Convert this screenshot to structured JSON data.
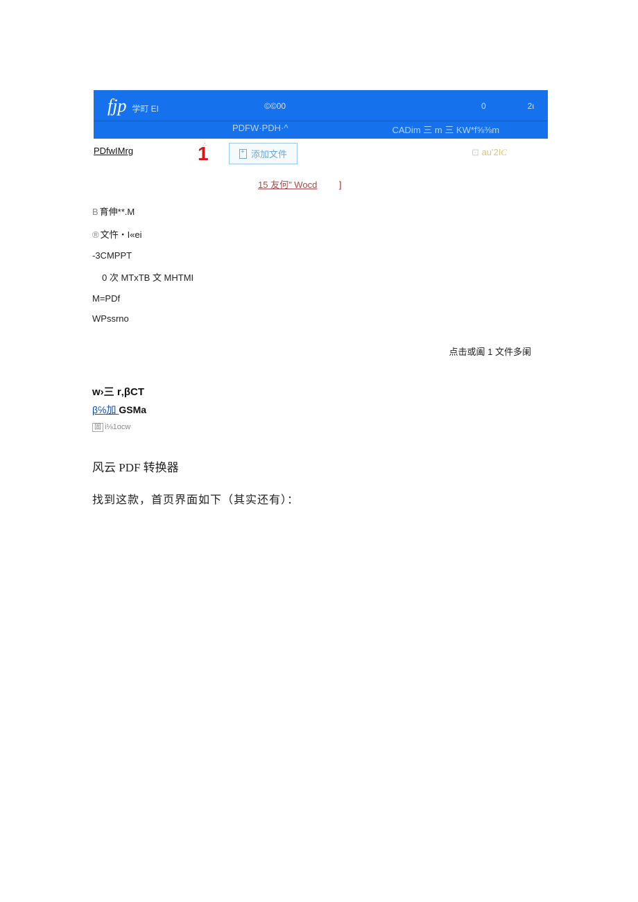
{
  "header": {
    "logo": "fjp",
    "logo_suffix": "学町 EI",
    "center": "©©00",
    "right1": "0",
    "right2": "2ι",
    "sub_left": "PDFW·PDH·^",
    "sub_right": "CADim 三 m 三 KW*f⅝⅜m"
  },
  "toolbar": {
    "sidebar_first": "PDfwIMrg",
    "red_mark": "1",
    "add_file_label": "添加文件",
    "output_icon": "⊡",
    "output_text": "au'2I",
    "output_suffix": "C"
  },
  "subtext": {
    "text": "15 友何\" Wocd",
    "bracket": "]"
  },
  "sidebar": {
    "items": [
      {
        "prefix": "B",
        "text": "育伸**.M"
      },
      {
        "prefix": "®",
        "text": "文忤・I«ei"
      },
      {
        "prefix": "",
        "text": "-3CMPPT"
      },
      {
        "prefix": "",
        "text": "0 次 MTxTB 文 MHTMI",
        "indent": true
      },
      {
        "prefix": "",
        "text": "M=PDf"
      },
      {
        "prefix": "",
        "text": "WPssrno"
      }
    ]
  },
  "drop_hint": "点击或阖 1 文件多阑",
  "bottom": {
    "line1": "w›三 r‚βCT",
    "line2_link": "β℅",
    "line2_mid": "加 ",
    "line2_bold": "GSMa",
    "line3_box": "固",
    "line3_text": "i⅛1ocw"
  },
  "article": {
    "title": "风云 PDF 转换器",
    "text": "找到这款，首页界面如下（其实还有）："
  }
}
